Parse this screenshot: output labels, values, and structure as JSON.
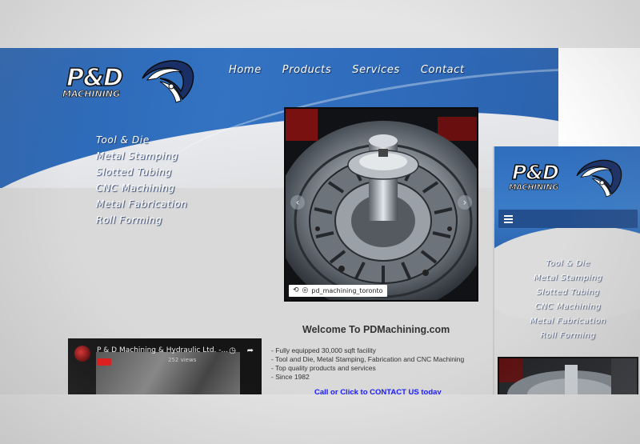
{
  "brand": {
    "logo_main": "P&D",
    "logo_sub": "MACHINING"
  },
  "nav": {
    "items": [
      "Home",
      "Products",
      "Services",
      "Contact"
    ]
  },
  "services_menu": {
    "items": [
      "Tool & Die",
      "Metal Stamping",
      "Slotted Tubing",
      "CNC Machining",
      "Metal Fabrication",
      "Roll Forming"
    ]
  },
  "slider": {
    "instagram_handle": "pd_machining_toronto",
    "prev_icon": "chevron-left-icon",
    "next_icon": "chevron-right-icon"
  },
  "video": {
    "title": "P & D Machining & Hydraulic Ltd. -...",
    "views": "252 views"
  },
  "welcome": {
    "heading": "Welcome To PDMachining.com",
    "bullets": [
      "- Fully equipped 30,000 sqft facility",
      "- Tool and Die, Metal Stamping, Fabrication and CNC Machining",
      "- Top quality products and services",
      "- Since 1982"
    ],
    "cta": "Call or Click to CONTACT US today"
  },
  "mobile": {
    "logo_main": "P&D",
    "logo_sub": "MACHINING",
    "menu_icon": "hamburger-menu-icon",
    "menu_items": [
      "Tool & Die",
      "Metal Stamping",
      "Slotted Tubing",
      "CNC Machining",
      "Metal Fabrication",
      "Roll Forming"
    ]
  },
  "colors": {
    "brand_blue": "#2f6bba",
    "dark_blue": "#244f8e",
    "link_blue": "#1a1aff"
  }
}
